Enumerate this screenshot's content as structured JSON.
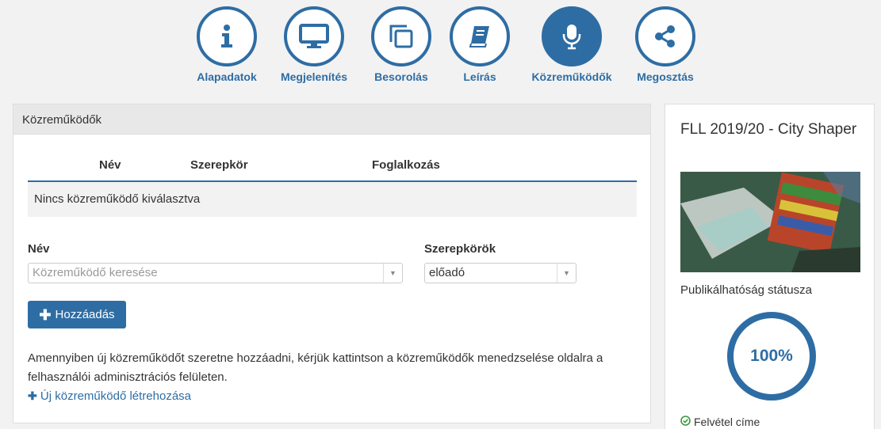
{
  "steps": [
    {
      "label": "Alapadatok",
      "icon": "info-icon"
    },
    {
      "label": "Megjelenítés",
      "icon": "monitor-icon"
    },
    {
      "label": "Besorolás",
      "icon": "copy-icon"
    },
    {
      "label": "Leírás",
      "icon": "book-icon"
    },
    {
      "label": "Közreműködők",
      "icon": "microphone-icon",
      "active": true
    },
    {
      "label": "Megosztás",
      "icon": "share-icon"
    }
  ],
  "panel": {
    "title": "Közreműködők",
    "table": {
      "columns": [
        "Név",
        "Szerepkör",
        "Foglalkozás"
      ],
      "empty_text": "Nincs közreműködő kiválasztva"
    },
    "form": {
      "name_label": "Név",
      "name_placeholder": "Közreműködő keresése",
      "roles_label": "Szerepkörök",
      "role_value": "előadó"
    },
    "add_button": "Hozzáadás",
    "info_text": "Amennyiben új közreműködőt szeretne hozzáadni, kérjük kattintson a közreműködők menedzselése oldalra a felhasználói adminisztrációs felületen.",
    "new_link": "Új közreműködő létrehozása"
  },
  "card": {
    "title": "FLL 2019/20 - City Shaper",
    "status_label": "Publikálhatóság státusza",
    "progress": 1.0,
    "progress_text": "100%",
    "check_item": "Felvétel címe"
  },
  "colors": {
    "accent": "#2e6da4",
    "success": "#3c9a3c"
  }
}
